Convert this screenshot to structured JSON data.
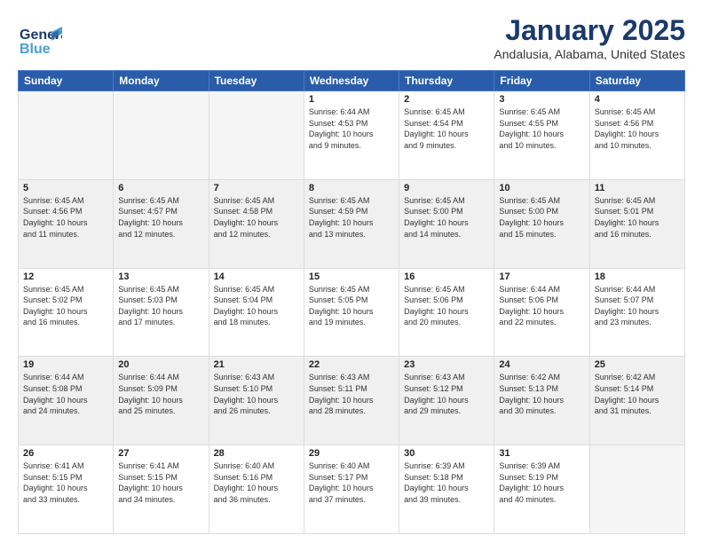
{
  "header": {
    "logo_line1": "General",
    "logo_line2": "Blue",
    "title": "January 2025",
    "subtitle": "Andalusia, Alabama, United States"
  },
  "weekdays": [
    "Sunday",
    "Monday",
    "Tuesday",
    "Wednesday",
    "Thursday",
    "Friday",
    "Saturday"
  ],
  "weeks": [
    [
      {
        "day": "",
        "info": "",
        "empty": true
      },
      {
        "day": "",
        "info": "",
        "empty": true
      },
      {
        "day": "",
        "info": "",
        "empty": true
      },
      {
        "day": "1",
        "info": "Sunrise: 6:44 AM\nSunset: 4:53 PM\nDaylight: 10 hours\nand 9 minutes.",
        "empty": false
      },
      {
        "day": "2",
        "info": "Sunrise: 6:45 AM\nSunset: 4:54 PM\nDaylight: 10 hours\nand 9 minutes.",
        "empty": false
      },
      {
        "day": "3",
        "info": "Sunrise: 6:45 AM\nSunset: 4:55 PM\nDaylight: 10 hours\nand 10 minutes.",
        "empty": false
      },
      {
        "day": "4",
        "info": "Sunrise: 6:45 AM\nSunset: 4:56 PM\nDaylight: 10 hours\nand 10 minutes.",
        "empty": false
      }
    ],
    [
      {
        "day": "5",
        "info": "Sunrise: 6:45 AM\nSunset: 4:56 PM\nDaylight: 10 hours\nand 11 minutes.",
        "empty": false,
        "gray": true
      },
      {
        "day": "6",
        "info": "Sunrise: 6:45 AM\nSunset: 4:57 PM\nDaylight: 10 hours\nand 12 minutes.",
        "empty": false,
        "gray": true
      },
      {
        "day": "7",
        "info": "Sunrise: 6:45 AM\nSunset: 4:58 PM\nDaylight: 10 hours\nand 12 minutes.",
        "empty": false,
        "gray": true
      },
      {
        "day": "8",
        "info": "Sunrise: 6:45 AM\nSunset: 4:59 PM\nDaylight: 10 hours\nand 13 minutes.",
        "empty": false,
        "gray": true
      },
      {
        "day": "9",
        "info": "Sunrise: 6:45 AM\nSunset: 5:00 PM\nDaylight: 10 hours\nand 14 minutes.",
        "empty": false,
        "gray": true
      },
      {
        "day": "10",
        "info": "Sunrise: 6:45 AM\nSunset: 5:00 PM\nDaylight: 10 hours\nand 15 minutes.",
        "empty": false,
        "gray": true
      },
      {
        "day": "11",
        "info": "Sunrise: 6:45 AM\nSunset: 5:01 PM\nDaylight: 10 hours\nand 16 minutes.",
        "empty": false,
        "gray": true
      }
    ],
    [
      {
        "day": "12",
        "info": "Sunrise: 6:45 AM\nSunset: 5:02 PM\nDaylight: 10 hours\nand 16 minutes.",
        "empty": false
      },
      {
        "day": "13",
        "info": "Sunrise: 6:45 AM\nSunset: 5:03 PM\nDaylight: 10 hours\nand 17 minutes.",
        "empty": false
      },
      {
        "day": "14",
        "info": "Sunrise: 6:45 AM\nSunset: 5:04 PM\nDaylight: 10 hours\nand 18 minutes.",
        "empty": false
      },
      {
        "day": "15",
        "info": "Sunrise: 6:45 AM\nSunset: 5:05 PM\nDaylight: 10 hours\nand 19 minutes.",
        "empty": false
      },
      {
        "day": "16",
        "info": "Sunrise: 6:45 AM\nSunset: 5:06 PM\nDaylight: 10 hours\nand 20 minutes.",
        "empty": false
      },
      {
        "day": "17",
        "info": "Sunrise: 6:44 AM\nSunset: 5:06 PM\nDaylight: 10 hours\nand 22 minutes.",
        "empty": false
      },
      {
        "day": "18",
        "info": "Sunrise: 6:44 AM\nSunset: 5:07 PM\nDaylight: 10 hours\nand 23 minutes.",
        "empty": false
      }
    ],
    [
      {
        "day": "19",
        "info": "Sunrise: 6:44 AM\nSunset: 5:08 PM\nDaylight: 10 hours\nand 24 minutes.",
        "empty": false,
        "gray": true
      },
      {
        "day": "20",
        "info": "Sunrise: 6:44 AM\nSunset: 5:09 PM\nDaylight: 10 hours\nand 25 minutes.",
        "empty": false,
        "gray": true
      },
      {
        "day": "21",
        "info": "Sunrise: 6:43 AM\nSunset: 5:10 PM\nDaylight: 10 hours\nand 26 minutes.",
        "empty": false,
        "gray": true
      },
      {
        "day": "22",
        "info": "Sunrise: 6:43 AM\nSunset: 5:11 PM\nDaylight: 10 hours\nand 28 minutes.",
        "empty": false,
        "gray": true
      },
      {
        "day": "23",
        "info": "Sunrise: 6:43 AM\nSunset: 5:12 PM\nDaylight: 10 hours\nand 29 minutes.",
        "empty": false,
        "gray": true
      },
      {
        "day": "24",
        "info": "Sunrise: 6:42 AM\nSunset: 5:13 PM\nDaylight: 10 hours\nand 30 minutes.",
        "empty": false,
        "gray": true
      },
      {
        "day": "25",
        "info": "Sunrise: 6:42 AM\nSunset: 5:14 PM\nDaylight: 10 hours\nand 31 minutes.",
        "empty": false,
        "gray": true
      }
    ],
    [
      {
        "day": "26",
        "info": "Sunrise: 6:41 AM\nSunset: 5:15 PM\nDaylight: 10 hours\nand 33 minutes.",
        "empty": false
      },
      {
        "day": "27",
        "info": "Sunrise: 6:41 AM\nSunset: 5:15 PM\nDaylight: 10 hours\nand 34 minutes.",
        "empty": false
      },
      {
        "day": "28",
        "info": "Sunrise: 6:40 AM\nSunset: 5:16 PM\nDaylight: 10 hours\nand 36 minutes.",
        "empty": false
      },
      {
        "day": "29",
        "info": "Sunrise: 6:40 AM\nSunset: 5:17 PM\nDaylight: 10 hours\nand 37 minutes.",
        "empty": false
      },
      {
        "day": "30",
        "info": "Sunrise: 6:39 AM\nSunset: 5:18 PM\nDaylight: 10 hours\nand 39 minutes.",
        "empty": false
      },
      {
        "day": "31",
        "info": "Sunrise: 6:39 AM\nSunset: 5:19 PM\nDaylight: 10 hours\nand 40 minutes.",
        "empty": false
      },
      {
        "day": "",
        "info": "",
        "empty": true
      }
    ]
  ]
}
